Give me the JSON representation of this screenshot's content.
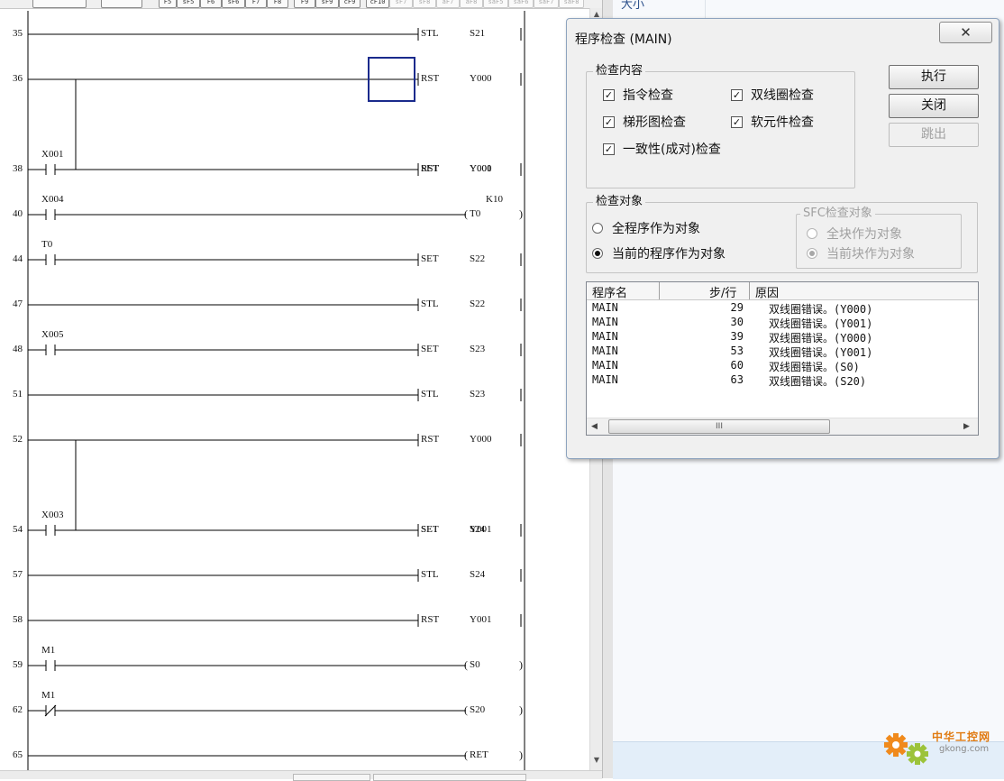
{
  "toolbar": {
    "buttons": [
      "F5",
      "sF5",
      "F6",
      "sF6",
      "F7",
      "F8",
      "F9",
      "sF9",
      "cF9",
      "cF10",
      "sF7",
      "sF8",
      "aF7",
      "aF8",
      "saF5",
      "saF6",
      "saF7",
      "saF8"
    ]
  },
  "ladder": {
    "rungs": [
      {
        "step": "35",
        "contact": "",
        "contact_type": "none",
        "coil": "STL",
        "operand": "S21",
        "coil_type": "apply",
        "param": "",
        "branch": null
      },
      {
        "step": "36",
        "contact": "",
        "contact_type": "none",
        "coil": "RST",
        "operand": "Y000",
        "coil_type": "apply",
        "param": "",
        "branch": {
          "coil": "RST",
          "operand": "Y001"
        }
      },
      {
        "step": "38",
        "contact": "X001",
        "contact_type": "NO",
        "coil": "SET",
        "operand": "Y000",
        "coil_type": "apply",
        "param": "",
        "branch": null
      },
      {
        "step": "40",
        "contact": "X004",
        "contact_type": "NO",
        "coil": "T0",
        "operand": "",
        "coil_type": "output",
        "param": "K10",
        "branch": null
      },
      {
        "step": "44",
        "contact": "T0",
        "contact_type": "NO",
        "coil": "SET",
        "operand": "S22",
        "coil_type": "apply",
        "param": "",
        "branch": null
      },
      {
        "step": "47",
        "contact": "",
        "contact_type": "none",
        "coil": "STL",
        "operand": "S22",
        "coil_type": "apply",
        "param": "",
        "branch": null
      },
      {
        "step": "48",
        "contact": "X005",
        "contact_type": "NO",
        "coil": "SET",
        "operand": "S23",
        "coil_type": "apply",
        "param": "",
        "branch": null
      },
      {
        "step": "51",
        "contact": "",
        "contact_type": "none",
        "coil": "STL",
        "operand": "S23",
        "coil_type": "apply",
        "param": "",
        "branch": null
      },
      {
        "step": "52",
        "contact": "",
        "contact_type": "none",
        "coil": "RST",
        "operand": "Y000",
        "coil_type": "apply",
        "param": "",
        "branch": {
          "coil": "SET",
          "operand": "Y001"
        }
      },
      {
        "step": "54",
        "contact": "X003",
        "contact_type": "NO",
        "coil": "SET",
        "operand": "S24",
        "coil_type": "apply",
        "param": "",
        "branch": null
      },
      {
        "step": "57",
        "contact": "",
        "contact_type": "none",
        "coil": "STL",
        "operand": "S24",
        "coil_type": "apply",
        "param": "",
        "branch": null
      },
      {
        "step": "58",
        "contact": "",
        "contact_type": "none",
        "coil": "RST",
        "operand": "Y001",
        "coil_type": "apply",
        "param": "",
        "branch": null
      },
      {
        "step": "59",
        "contact": "M1",
        "contact_type": "NO",
        "coil": "S0",
        "operand": "",
        "coil_type": "output",
        "param": "",
        "branch": null
      },
      {
        "step": "62",
        "contact": "M1",
        "contact_type": "NC",
        "coil": "S20",
        "operand": "",
        "coil_type": "output",
        "param": "",
        "branch": null
      },
      {
        "step": "65",
        "contact": "",
        "contact_type": "none",
        "coil": "RET",
        "operand": "",
        "coil_type": "ret",
        "param": "",
        "branch": null
      }
    ]
  },
  "right_pane": {
    "top_text": "大小"
  },
  "dialog": {
    "title": "程序检查 (MAIN)",
    "close_glyph": "✕",
    "check_content": {
      "label": "检查内容",
      "options": [
        {
          "label": "指令检查",
          "checked": true
        },
        {
          "label": "双线圈检查",
          "checked": true
        },
        {
          "label": "梯形图检查",
          "checked": true
        },
        {
          "label": "软元件检查",
          "checked": true
        },
        {
          "label": "一致性(成对)检查",
          "checked": true
        }
      ]
    },
    "buttons": {
      "execute": "执行",
      "close": "关闭",
      "jump": "跳出"
    },
    "check_target": {
      "label": "检查对象",
      "all_program": "全程序作为对象",
      "current_program": "当前的程序作为对象",
      "selected": "current_program"
    },
    "sfc_target": {
      "label": "SFC检查对象",
      "all_blocks": "全块作为对象",
      "current_block": "当前块作为对象",
      "selected": "current_block"
    },
    "results": {
      "columns": [
        "程序名",
        "步/行",
        "原因"
      ],
      "rows": [
        {
          "program": "MAIN",
          "step": "29",
          "reason": "双线圈错误。(Y000)"
        },
        {
          "program": "MAIN",
          "step": "30",
          "reason": "双线圈错误。(Y001)"
        },
        {
          "program": "MAIN",
          "step": "39",
          "reason": "双线圈错误。(Y000)"
        },
        {
          "program": "MAIN",
          "step": "53",
          "reason": "双线圈错误。(Y001)"
        },
        {
          "program": "MAIN",
          "step": "60",
          "reason": "双线圈错误。(S0)"
        },
        {
          "program": "MAIN",
          "step": "63",
          "reason": "双线圈错误。(S20)"
        }
      ],
      "scroll_thumb": "III"
    }
  },
  "watermark": {
    "line1": "中华工控网",
    "line2": "gkong.com"
  },
  "colors": {
    "ladder_line": "#000000",
    "cursor": "#1a2a8c",
    "dialog_bg": "#f0f0f0",
    "watermark": "#e07a10"
  }
}
